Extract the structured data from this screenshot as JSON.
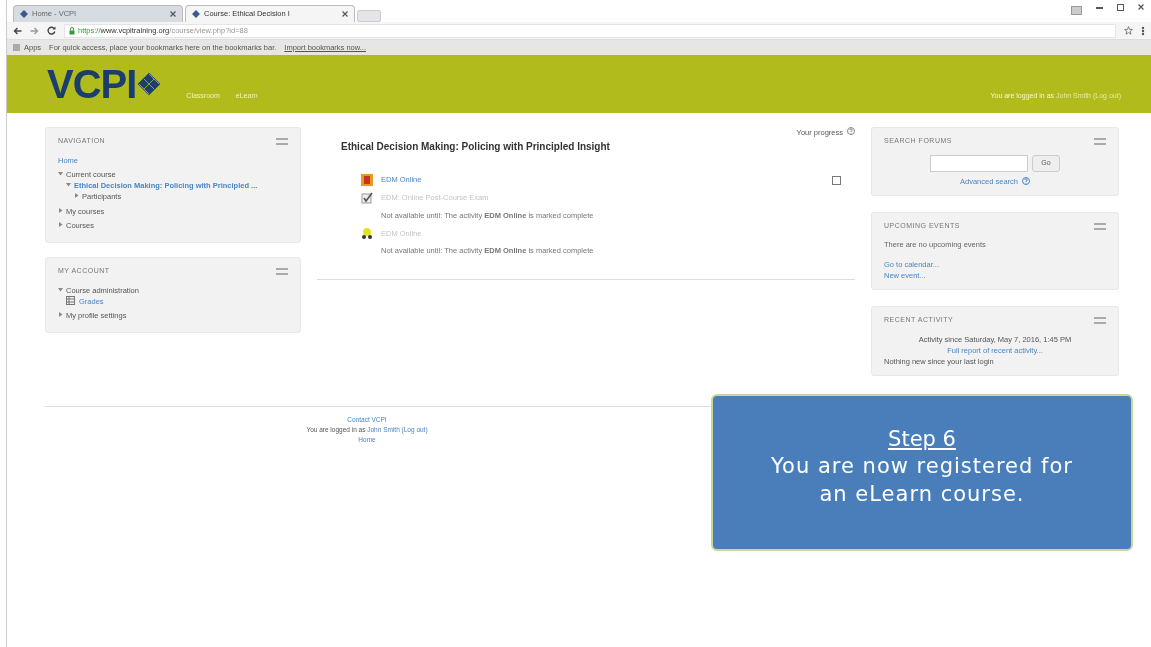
{
  "browser": {
    "tabs": [
      {
        "label": "Home - VCPI",
        "selected": false
      },
      {
        "label": "Course: Ethical Decision I",
        "selected": true
      }
    ],
    "url": {
      "scheme": "https://",
      "host": "www.vcpitraining.org",
      "path": "/course/view.php?id=88"
    },
    "bookmarks": {
      "apps": "Apps",
      "hint": "For quick access, place your bookmarks here on the bookmarks bar.",
      "import_link": "Import bookmarks now..."
    }
  },
  "header": {
    "logo": "VCPI",
    "menu": [
      "Classroom",
      "eLearn"
    ],
    "login": {
      "prefix": "You are logged in as ",
      "user": "John Smith",
      "logout": "(Log out)"
    }
  },
  "navigation": {
    "title": "NAVIGATION",
    "items": [
      {
        "label": "Home",
        "kind": "leaf"
      },
      {
        "label": "Current course",
        "kind": "branch",
        "expanded": true,
        "children": [
          {
            "label": "Ethical Decision Making: Policing with Principled ...",
            "kind": "branch",
            "expanded": true,
            "current": true,
            "children": [
              {
                "label": "Participants",
                "kind": "branch",
                "expanded": false
              }
            ]
          }
        ]
      },
      {
        "label": "My courses",
        "kind": "branch",
        "expanded": false
      },
      {
        "label": "Courses",
        "kind": "branch",
        "expanded": false
      }
    ]
  },
  "my_account": {
    "title": "MY ACCOUNT",
    "items": [
      {
        "label": "Course administration",
        "kind": "branch",
        "expanded": true,
        "children": [
          {
            "label": "Grades",
            "kind": "grades"
          }
        ]
      },
      {
        "label": "My profile settings",
        "kind": "branch",
        "expanded": false
      }
    ]
  },
  "course": {
    "progress_label": "Your progress",
    "title": "Ethical Decision Making: Policing with Principled Insight",
    "activities": [
      {
        "kind": "page",
        "name": "EDM Online",
        "available": true,
        "checkbox": {
          "checked": false
        }
      },
      {
        "kind": "quiz",
        "name": "EDM: Online Post-Course Exam",
        "available": false,
        "restriction": "Not available until: The activity **EDM Online** is marked complete"
      },
      {
        "kind": "certificate",
        "name": "EDM Online",
        "available": false,
        "restriction": "Not available until: The activity **EDM Online** is marked complete"
      }
    ]
  },
  "search_forums": {
    "title": "SEARCH FORUMS",
    "button": "Go",
    "advanced": "Advanced search"
  },
  "upcoming_events": {
    "title": "UPCOMING EVENTS",
    "message": "There are no upcoming events",
    "links": [
      "Go to calendar...",
      "New event..."
    ]
  },
  "recent_activity": {
    "title": "RECENT ACTIVITY",
    "since": "Activity since Saturday, May 7, 2016, 1:45 PM",
    "report": "Full report of recent activity...",
    "message": "Nothing new since your last login"
  },
  "footer": {
    "contact": "Contact VCPI",
    "login": {
      "prefix": "You are logged in as ",
      "user": "John Smith",
      "logout": "(Log out)"
    },
    "home": "Home"
  },
  "callout": {
    "title": "Step 6",
    "text": "You are now registered for an eLearn course."
  }
}
